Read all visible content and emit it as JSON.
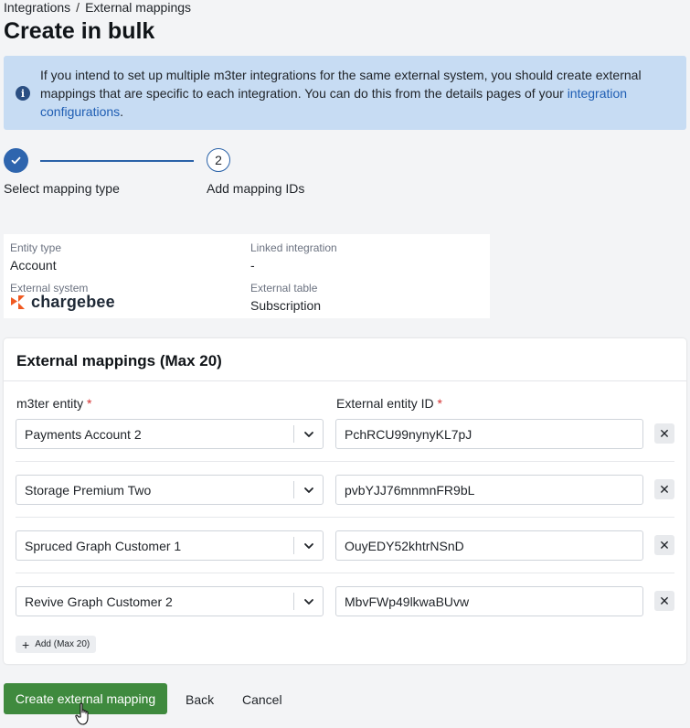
{
  "breadcrumb": {
    "items": [
      "Integrations",
      "External mappings"
    ],
    "separator": "/"
  },
  "page": {
    "title": "Create in bulk"
  },
  "info": {
    "text": "If you intend to set up multiple m3ter integrations for the same external system, you should create external mappings that are specific to each integration. You can do this from the details pages of your ",
    "link": "integration configurations",
    "suffix": "."
  },
  "stepper": {
    "steps": [
      {
        "label": "Select mapping type",
        "state": "done"
      },
      {
        "label": "Add mapping IDs",
        "number": "2",
        "state": "current"
      }
    ]
  },
  "details": {
    "entity_type_label": "Entity type",
    "entity_type": "Account",
    "linked_integration_label": "Linked integration",
    "linked_integration": "-",
    "external_system_label": "External system",
    "external_system_logo": "chargebee",
    "external_table_label": "External table",
    "external_table": "Subscription"
  },
  "mappings": {
    "title": "External mappings (Max 20)",
    "entity_col": "m3ter entity",
    "external_col": "External entity ID",
    "required_mark": "*",
    "rows": [
      {
        "entity": "Payments Account 2",
        "external_id": "PchRCU99nynyKL7pJ"
      },
      {
        "entity": "Storage Premium Two",
        "external_id": "pvbYJJ76mnmnFR9bL"
      },
      {
        "entity": "Spruced Graph Customer 1",
        "external_id": "OuyEDY52khtrNSnD"
      },
      {
        "entity": "Revive Graph Customer 2",
        "external_id": "MbvFWp49lkwaBUvw"
      }
    ],
    "add_label": "Add (Max 20)"
  },
  "actions": {
    "create": "Create external mapping",
    "back": "Back",
    "cancel": "Cancel"
  },
  "colors": {
    "primary": "#3f8a3e",
    "accent": "#2e65ae",
    "banner": "#c7dcf3",
    "required": "#d32f2f",
    "chargebee": "#f05a22"
  }
}
